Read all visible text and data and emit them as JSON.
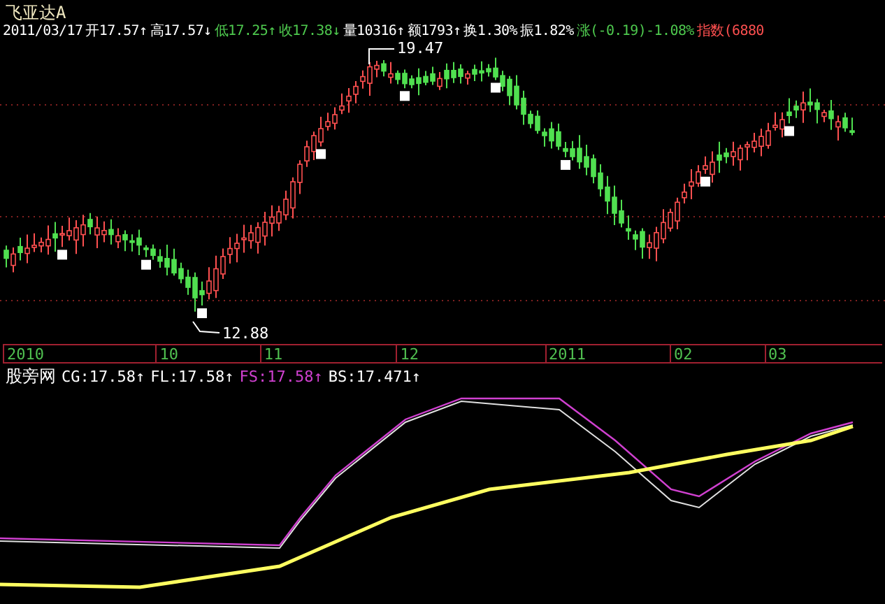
{
  "window": {
    "title": "飞亚达A"
  },
  "quote_bar": {
    "date": "2011/03/17",
    "items": [
      {
        "text": "开17.57↑",
        "color": "#ffffff"
      },
      {
        "text": "高17.57↓",
        "color": "#ffffff"
      },
      {
        "text": "低17.25↑",
        "color": "#4ec94e"
      },
      {
        "text": "收17.38↓",
        "color": "#4ec94e"
      },
      {
        "text": "量10316↑",
        "color": "#ffffff"
      },
      {
        "text": "额1793↑",
        "color": "#ffffff"
      },
      {
        "text": "换1.30%",
        "color": "#ffffff"
      },
      {
        "text": "振1.82%",
        "color": "#ffffff"
      },
      {
        "text": "涨(-0.19)-1.08%",
        "color": "#4ec94e"
      },
      {
        "text": "指数(6880",
        "color": "#ff5050"
      }
    ]
  },
  "price_chart": {
    "high_label": "19.47",
    "low_label": "12.88"
  },
  "time_axis": [
    "2010",
    "10",
    "11",
    "12",
    "2011",
    "02",
    "03"
  ],
  "indicator": {
    "name": "股旁网",
    "values": [
      {
        "text": "CG:17.58↑",
        "color": "#ffffff"
      },
      {
        "text": "FL:17.58↑",
        "color": "#ffffff"
      },
      {
        "text": "FS:17.58↑",
        "color": "#d040d0"
      },
      {
        "text": "BS:17.471↑",
        "color": "#ffffff"
      }
    ]
  }
}
